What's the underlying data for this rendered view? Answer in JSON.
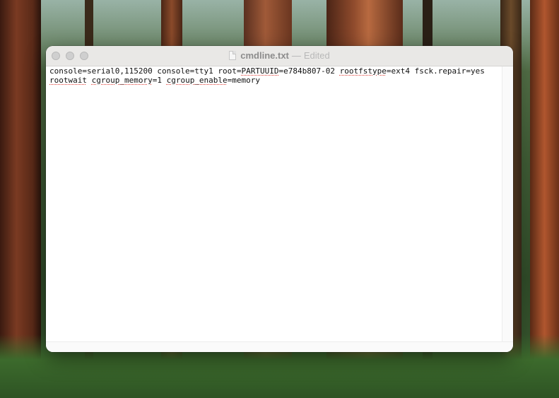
{
  "window": {
    "file_name": "cmdline.txt",
    "separator": "—",
    "status": "Edited"
  },
  "editor": {
    "line1": [
      "console=serial0,115200 console=tty1 root=",
      "PARTUUID",
      "=e784b807-02 ",
      "rootfstype",
      "=ext4 fsck.repair=yes"
    ],
    "line2": [
      "rootwait",
      " ",
      "cgroup_memory",
      "=1 ",
      "cgroup_enable",
      "=memory"
    ]
  },
  "icons": {
    "document": "document-icon",
    "close": "close-button",
    "minimize": "minimize-button",
    "zoom": "zoom-button"
  }
}
